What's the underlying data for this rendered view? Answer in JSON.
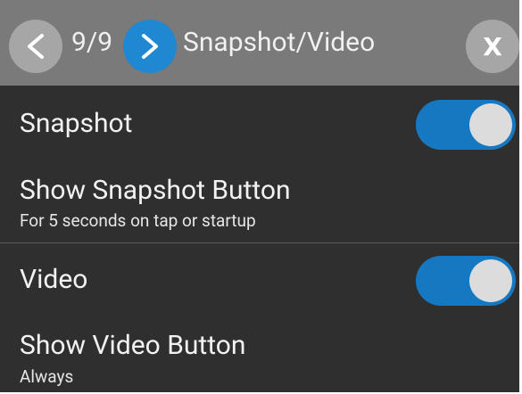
{
  "header": {
    "prev_label": "<",
    "page_counter": "9/9",
    "next_label": ">",
    "title": "Snapshot/Video",
    "close_label": "X"
  },
  "settings": [
    {
      "title": "Snapshot",
      "toggle_on": true
    },
    {
      "title": "Show Snapshot Button",
      "subtitle": "For 5 seconds on tap or startup"
    },
    {
      "title": "Video",
      "toggle_on": true
    },
    {
      "title": "Show Video Button",
      "subtitle": "Always"
    }
  ],
  "colors": {
    "accent": "#1e88d2",
    "toggle_track": "#1778c2",
    "header_bg": "#7a7a7a",
    "body_bg": "#2f2f2f"
  }
}
